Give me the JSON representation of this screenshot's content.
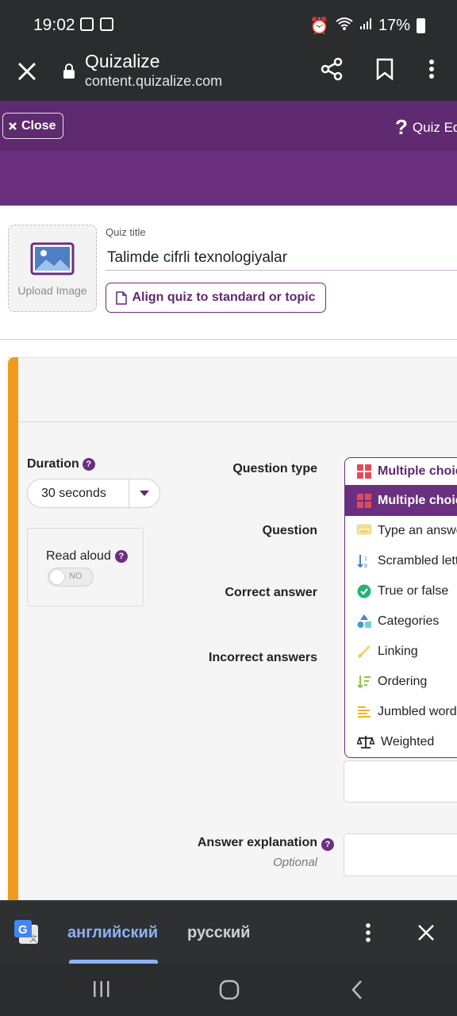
{
  "status_bar": {
    "time": "19:02",
    "battery": "17%"
  },
  "browser": {
    "title": "Quizalize",
    "url": "content.quizalize.com"
  },
  "header": {
    "close_label": "Close",
    "quiz_editor_label": "Quiz Ed"
  },
  "quiz": {
    "upload_label": "Upload Image",
    "title_label": "Quiz title",
    "title_value": "Talimde cifrli texnologiyalar",
    "align_button": "Align quiz to standard or topic"
  },
  "question": {
    "duration_label": "Duration",
    "duration_value": "30 seconds",
    "read_aloud_label": "Read aloud",
    "read_aloud_toggle": "NO",
    "labels": {
      "question_type": "Question type",
      "question": "Question",
      "correct_answer": "Correct answer",
      "incorrect_answers": "Incorrect answers",
      "answer_explanation": "Answer explanation",
      "optional": "Optional"
    },
    "question_type_selected": "Multiple choice",
    "question_type_options": [
      {
        "label": "Multiple choice",
        "icon": "grid-icon"
      },
      {
        "label": "Type an answer",
        "icon": "keyboard-icon"
      },
      {
        "label": "Scrambled letters",
        "icon": "sort-icon"
      },
      {
        "label": "True or false",
        "icon": "check-circle-icon"
      },
      {
        "label": "Categories",
        "icon": "shapes-icon"
      },
      {
        "label": "Linking",
        "icon": "link-icon"
      },
      {
        "label": "Ordering",
        "icon": "ordering-icon"
      },
      {
        "label": "Jumbled words",
        "icon": "lines-icon"
      },
      {
        "label": "Weighted",
        "icon": "scale-icon"
      }
    ]
  },
  "translate_bar": {
    "source_lang": "английский",
    "target_lang": "русский"
  },
  "colors": {
    "purple": "#6b2f7f",
    "orange": "#f29b1b",
    "blue": "#8ab4f8"
  }
}
